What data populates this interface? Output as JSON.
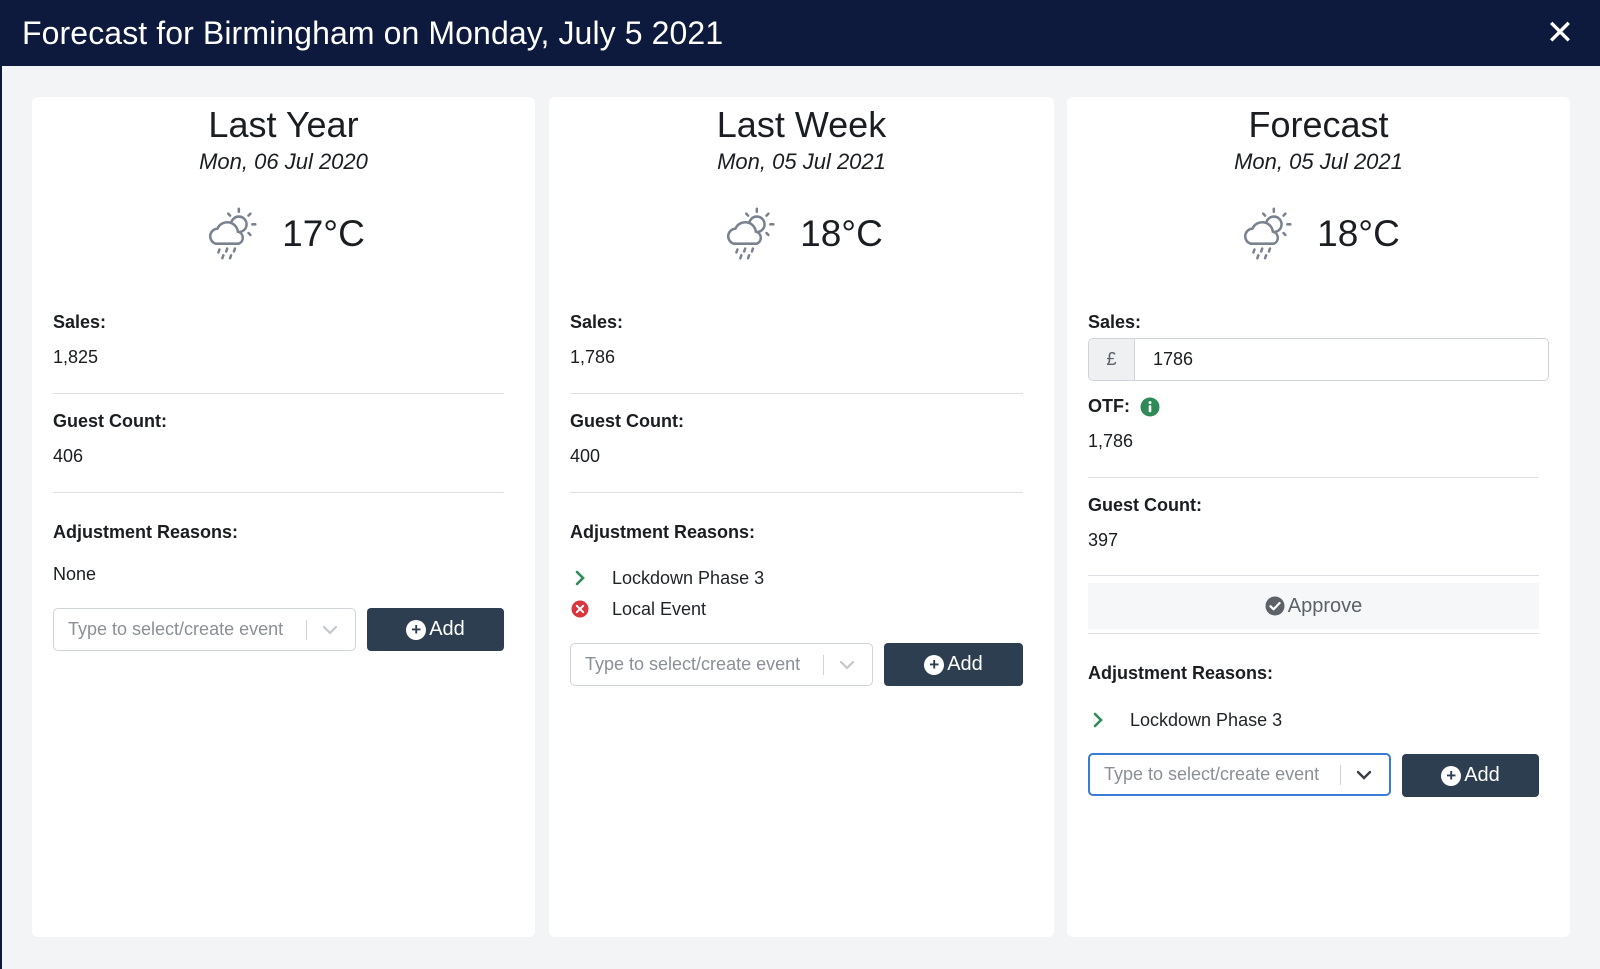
{
  "header": {
    "title": "Forecast for Birmingham on Monday, July 5 2021",
    "close_label": "✕"
  },
  "colors": {
    "header_bg": "#0e1a3d",
    "button_bg": "#2d3e50",
    "chevron_green": "#2e8b57",
    "remove_red": "#d9363e",
    "info_green": "#2e8b57",
    "focus_blue": "#3a7bd5"
  },
  "columns": [
    {
      "title": "Last Year",
      "date": "Mon, 06 Jul 2020",
      "weather_icon": "cloud-sun-rain-icon",
      "temperature": "17°C",
      "sales_label": "Sales:",
      "sales_value": "1,825",
      "guest_label": "Guest Count:",
      "guest_value": "406",
      "reasons_label": "Adjustment Reasons:",
      "reasons_none": "None",
      "select_placeholder": "Type to select/create event",
      "add_label": "Add"
    },
    {
      "title": "Last Week",
      "date": "Mon, 05 Jul 2021",
      "weather_icon": "cloud-sun-rain-icon",
      "temperature": "18°C",
      "sales_label": "Sales:",
      "sales_value": "1,786",
      "guest_label": "Guest Count:",
      "guest_value": "400",
      "reasons_label": "Adjustment Reasons:",
      "reasons": [
        {
          "label": "Lockdown Phase 3",
          "icon": "chevron-right-icon"
        },
        {
          "label": "Local Event",
          "icon": "remove-circle-icon"
        }
      ],
      "select_placeholder": "Type to select/create event",
      "add_label": "Add"
    },
    {
      "title": "Forecast",
      "date": "Mon, 05 Jul 2021",
      "weather_icon": "cloud-sun-rain-icon",
      "temperature": "18°C",
      "sales_label": "Sales:",
      "currency_prefix": "£",
      "sales_input_value": "1786",
      "otf_label": "OTF:",
      "otf_value": "1,786",
      "guest_label": "Guest Count:",
      "guest_value": "397",
      "approve_label": "Approve",
      "reasons_label": "Adjustment Reasons:",
      "reasons": [
        {
          "label": "Lockdown Phase 3",
          "icon": "chevron-right-icon"
        }
      ],
      "select_placeholder": "Type to select/create event",
      "add_label": "Add"
    }
  ]
}
